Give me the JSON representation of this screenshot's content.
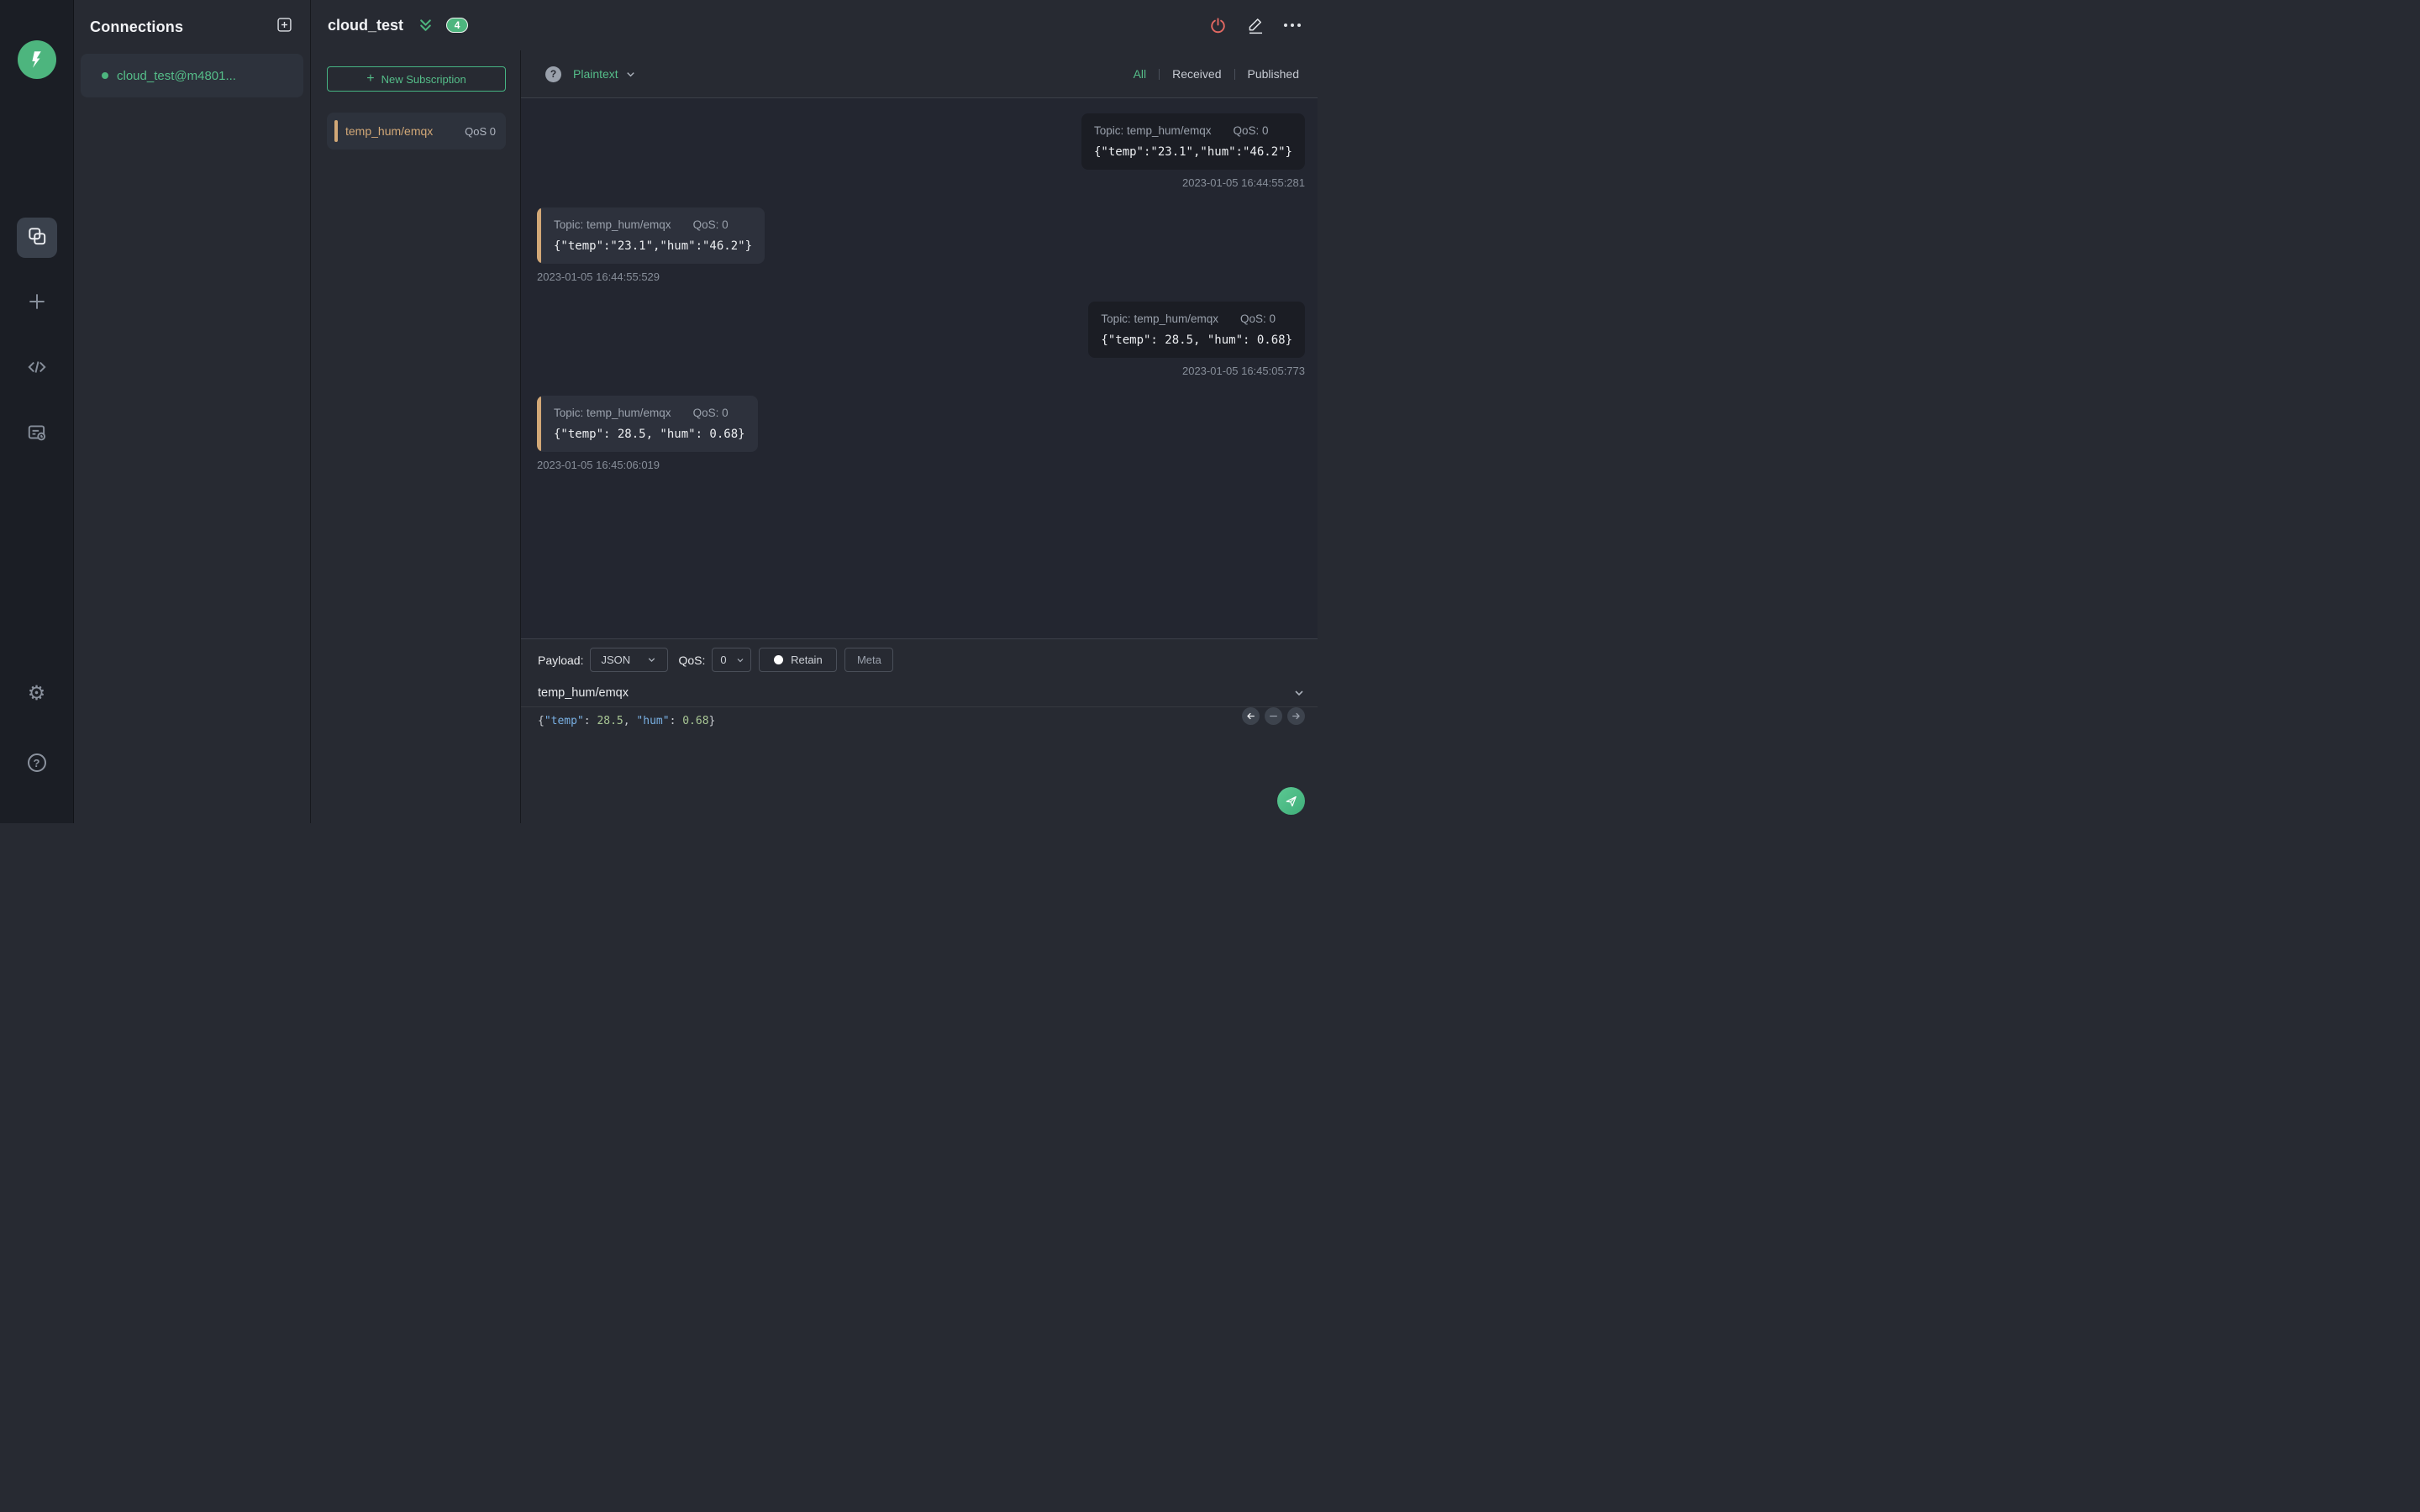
{
  "colors": {
    "accent-green": "#46b483",
    "text-green": "#55bd89",
    "badge-green": "#4db57e",
    "tan": "#d2a877",
    "power-red": "#e16862",
    "key-blue": "#79b0e3",
    "num-green": "#a9c795"
  },
  "glyphs": {
    "gear": "⚙",
    "help": "?",
    "format_help": "?"
  },
  "connections": {
    "title": "Connections",
    "items": [
      {
        "name": "cloud_test@m4801..."
      }
    ]
  },
  "header": {
    "title": "cloud_test",
    "badge": "4"
  },
  "subscriptions": {
    "new_label": "New Subscription",
    "plus": "+",
    "items": [
      {
        "topic": "temp_hum/emqx",
        "qos": "QoS 0"
      }
    ]
  },
  "messages": {
    "format": {
      "selected": "Plaintext"
    },
    "tabs": {
      "all": "All",
      "received": "Received",
      "published": "Published"
    },
    "items": [
      {
        "direction": "published",
        "topic": "Topic: temp_hum/emqx",
        "qos": "QoS: 0",
        "payload": "{\"temp\":\"23.1\",\"hum\":\"46.2\"}",
        "timestamp": "2023-01-05 16:44:55:281"
      },
      {
        "direction": "received",
        "topic": "Topic: temp_hum/emqx",
        "qos": "QoS: 0",
        "payload": "{\"temp\":\"23.1\",\"hum\":\"46.2\"}",
        "timestamp": "2023-01-05 16:44:55:529"
      },
      {
        "direction": "published",
        "topic": "Topic: temp_hum/emqx",
        "qos": "QoS: 0",
        "payload": "{\"temp\": 28.5, \"hum\": 0.68}",
        "timestamp": "2023-01-05 16:45:05:773"
      },
      {
        "direction": "received",
        "topic": "Topic: temp_hum/emqx",
        "qos": "QoS: 0",
        "payload": "{\"temp\": 28.5, \"hum\": 0.68}",
        "timestamp": "2023-01-05 16:45:06:019"
      }
    ]
  },
  "publish": {
    "payload_label": "Payload:",
    "payload_type": "JSON",
    "qos_label": "QoS:",
    "qos_value": "0",
    "retain_label": "Retain",
    "meta_label": "Meta",
    "topic": "temp_hum/emqx",
    "editor": {
      "p0": "{",
      "p1": "\"temp\"",
      "p2": ": ",
      "p3": "28.5",
      "p4": ", ",
      "p5": "\"hum\"",
      "p6": ": ",
      "p7": "0.68",
      "p8": "}"
    }
  }
}
